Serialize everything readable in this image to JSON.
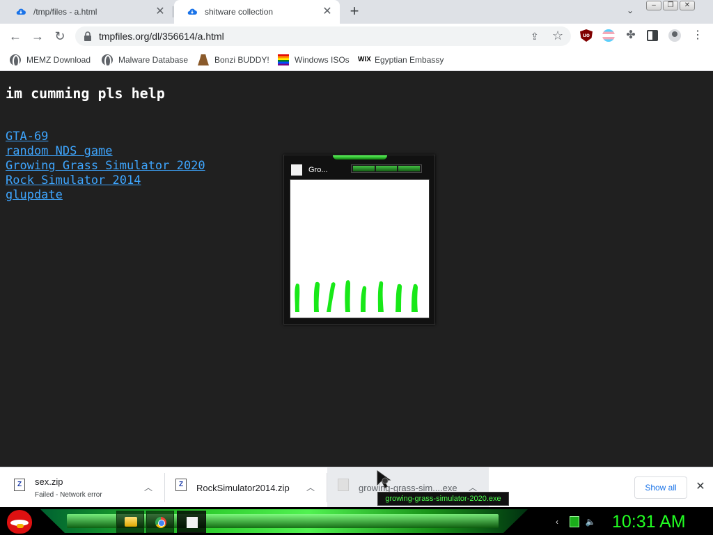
{
  "browser": {
    "tabs": [
      {
        "title": "/tmp/files - a.html",
        "active": false
      },
      {
        "title": "shitware collection",
        "active": true
      }
    ],
    "address": "tmpfiles.org/dl/356614/a.html",
    "bookmarks": [
      {
        "label": "MEMZ Download",
        "icon": "globe-icon"
      },
      {
        "label": "Malware Database",
        "icon": "globe-icon"
      },
      {
        "label": "Bonzi BUDDY!",
        "icon": "bonzi-icon"
      },
      {
        "label": "Windows ISOs",
        "icon": "rainbow-flag-icon"
      },
      {
        "label": "Egyptian Embassy",
        "icon": "wix-icon"
      }
    ]
  },
  "page": {
    "heading": "im cumming pls help",
    "links": [
      "GTA-69",
      "random NDS game",
      "Growing Grass Simulator 2020",
      "Rock Simulator 2014",
      "glupdate"
    ],
    "background": "#202020",
    "link_color": "#3ea6ff"
  },
  "grass_window": {
    "title": "Gro..."
  },
  "downloads": {
    "items": [
      {
        "name": "sex.zip",
        "status": "Failed - Network error"
      },
      {
        "name": "RockSimulator2014.zip",
        "status": ""
      },
      {
        "name": "growing-grass-sim....exe",
        "status": ""
      }
    ],
    "tooltip": "growing-grass-simulator-2020.exe",
    "show_all": "Show all"
  },
  "taskbar": {
    "clock": "10:31 AM",
    "accent": "#22ff22"
  }
}
